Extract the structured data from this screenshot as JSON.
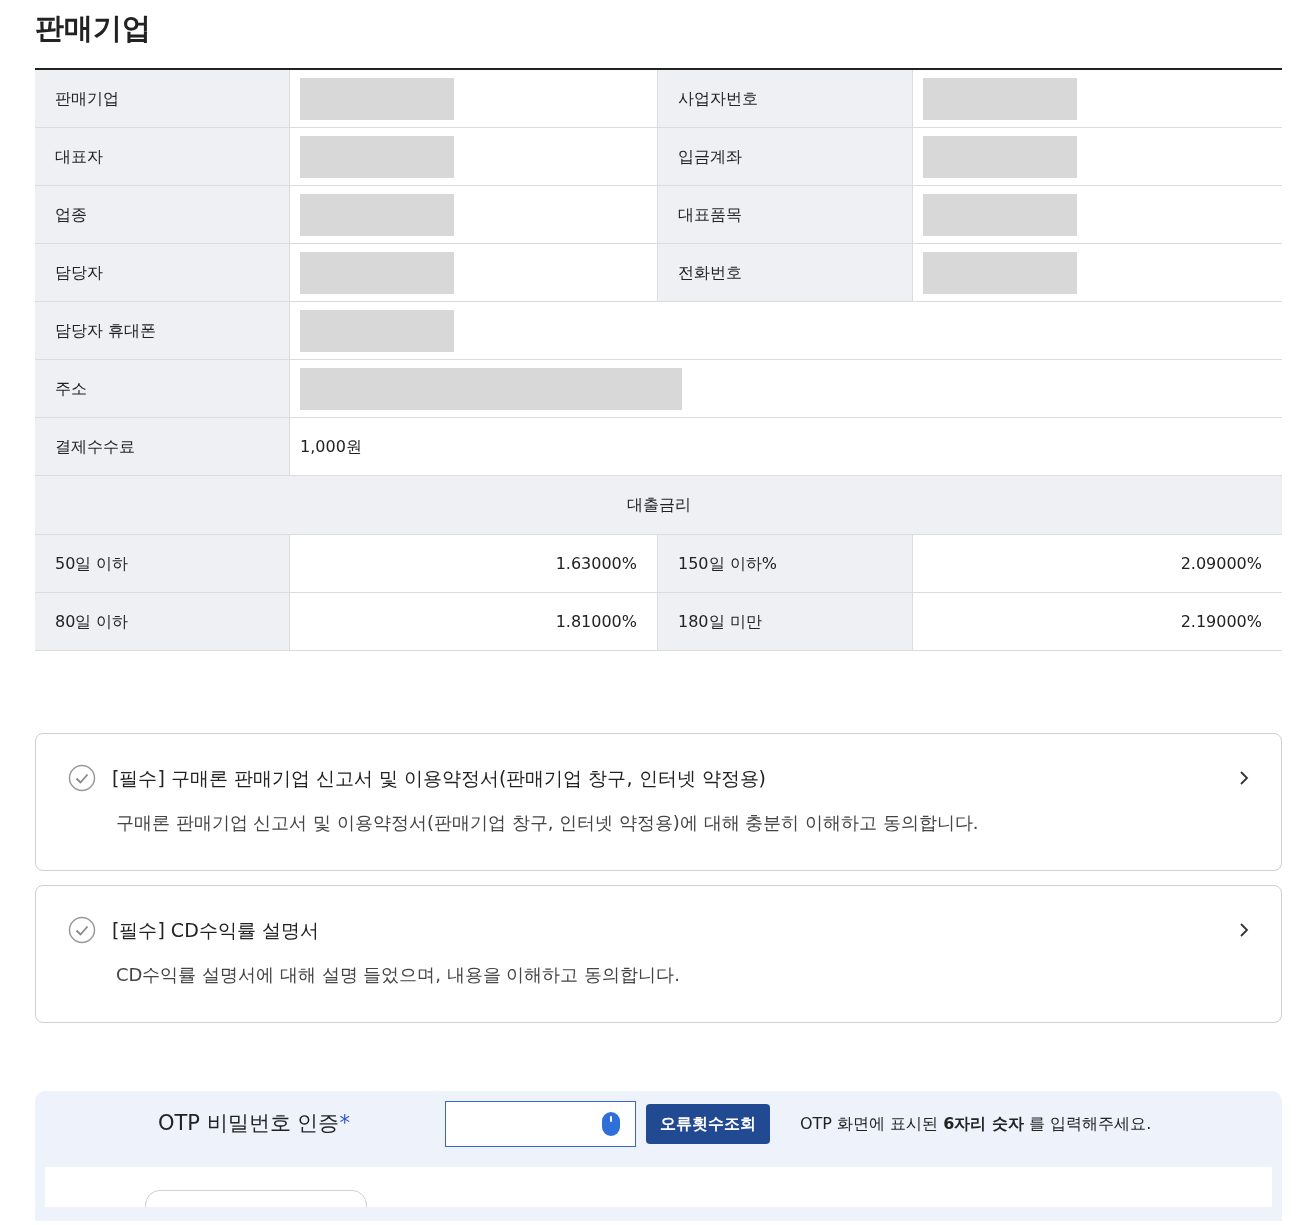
{
  "title": "판매기업",
  "info_table": {
    "rows": [
      {
        "cells": [
          {
            "label": "판매기업",
            "value": {
              "kind": "redacted"
            }
          },
          {
            "label": "사업자번호",
            "value": {
              "kind": "redacted"
            }
          }
        ]
      },
      {
        "cells": [
          {
            "label": "대표자",
            "value": {
              "kind": "redacted"
            }
          },
          {
            "label": "입금계좌",
            "value": {
              "kind": "redacted"
            }
          }
        ]
      },
      {
        "cells": [
          {
            "label": "업종",
            "value": {
              "kind": "redacted"
            }
          },
          {
            "label": "대표품목",
            "value": {
              "kind": "redacted"
            }
          }
        ]
      },
      {
        "cells": [
          {
            "label": "담당자",
            "value": {
              "kind": "redacted"
            }
          },
          {
            "label": "전화번호",
            "value": {
              "kind": "redacted"
            }
          }
        ]
      },
      {
        "cells": [
          {
            "label": "담당자 휴대폰",
            "value": {
              "kind": "redacted"
            }
          }
        ]
      },
      {
        "cells": [
          {
            "label": "주소",
            "value": {
              "kind": "redacted-wide"
            }
          }
        ]
      },
      {
        "cells": [
          {
            "label": "결제수수료",
            "value": {
              "kind": "text",
              "text": "1,000원"
            }
          }
        ]
      }
    ]
  },
  "rate_table": {
    "heading": "대출금리",
    "rows": [
      {
        "cells": [
          {
            "label": "50일 이하",
            "value": "1.63000%"
          },
          {
            "label": "150일 이하%",
            "value": "2.09000%"
          }
        ]
      },
      {
        "cells": [
          {
            "label": "80일 이하",
            "value": "1.81000%"
          },
          {
            "label": "180일 미만",
            "value": "2.19000%"
          }
        ]
      }
    ]
  },
  "agreements": [
    {
      "title": "[필수] 구매론 판매기업 신고서 및 이용약정서(판매기업 창구, 인터넷 약정용)",
      "description": "구매론 판매기업 신고서 및 이용약정서(판매기업 창구, 인터넷 약정용)에 대해 충분히 이해하고 동의합니다.",
      "checked": false
    },
    {
      "title": "[필수] CD수익률 설명서",
      "description": "CD수익률 설명서에 대해 설명 들었으며, 내용을 이해하고 동의합니다.",
      "checked": false
    }
  ],
  "otp": {
    "label": "OTP 비밀번호 인증",
    "required_mark": "*",
    "button": "오류횟수조회",
    "hint": "OTP 화면에 표시된 **6자리 숫자** 를 입력해주세요."
  }
}
